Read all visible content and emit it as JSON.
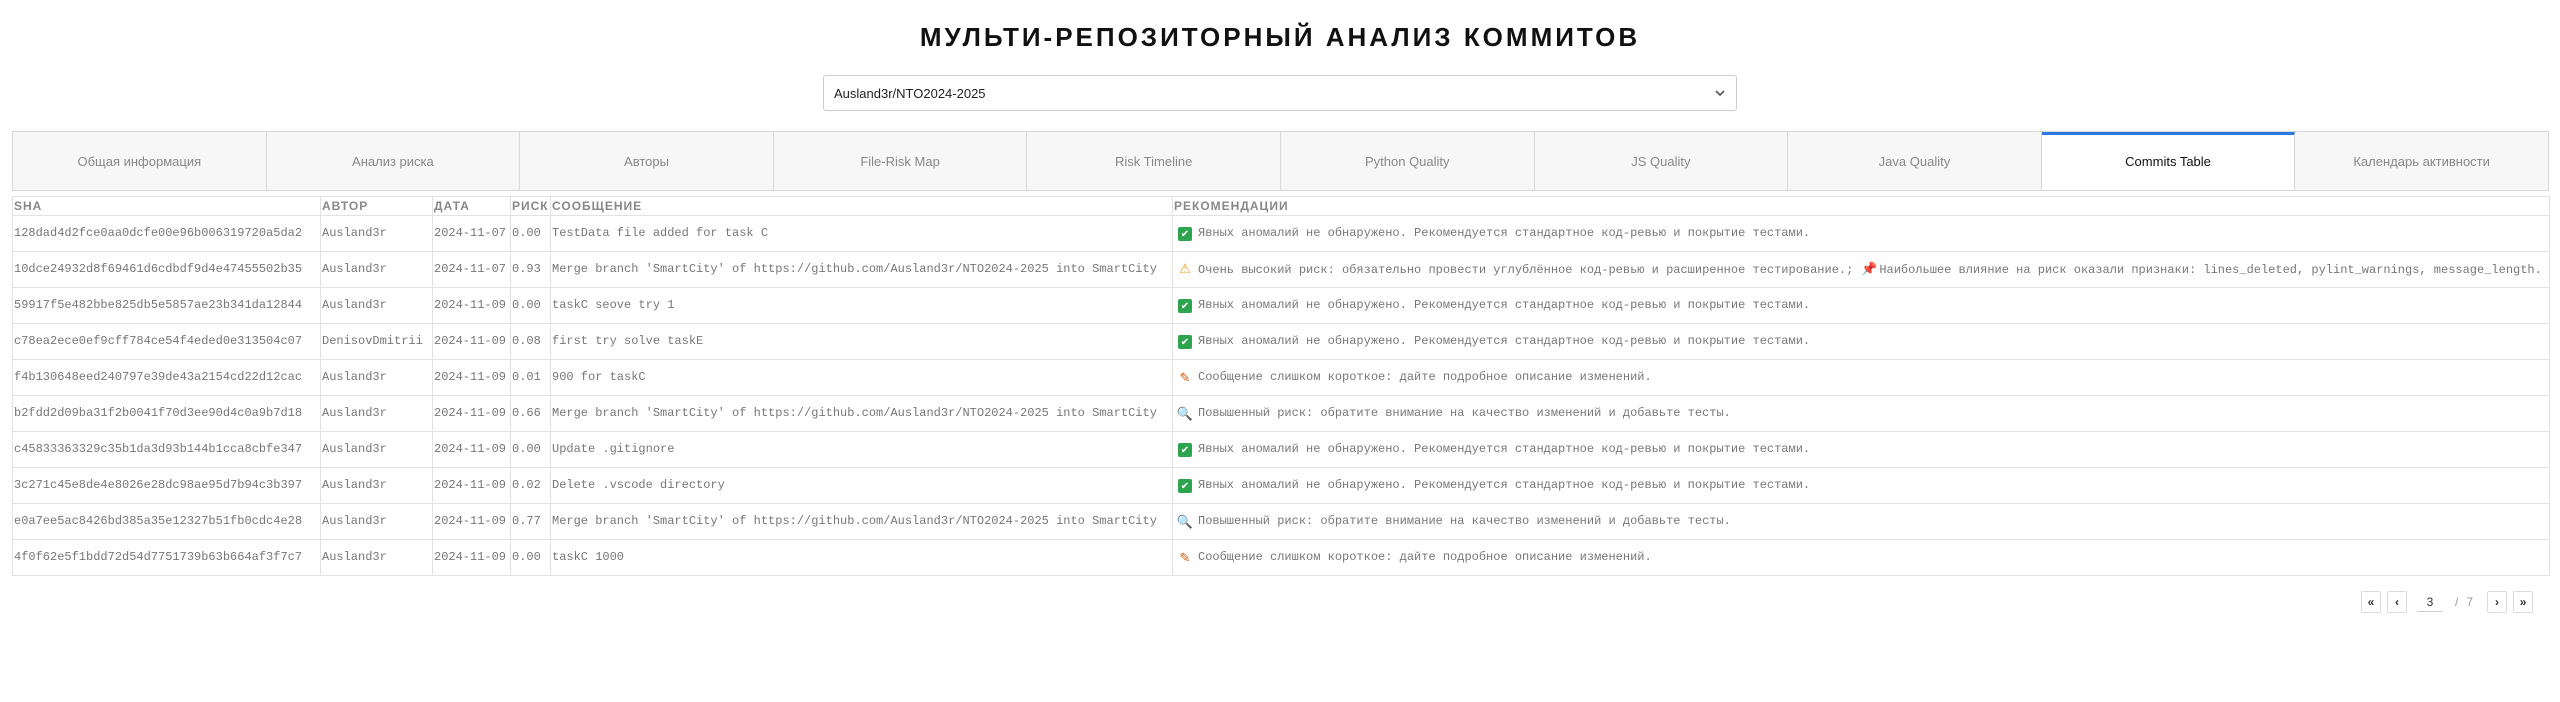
{
  "title": "МУЛЬТИ-РЕПОЗИТОРНЫЙ АНАЛИЗ КОММИТОВ",
  "repo_select": {
    "value": "Ausland3r/NTO2024-2025"
  },
  "tabs": [
    {
      "label": "Общая информация",
      "active": false
    },
    {
      "label": "Анализ риска",
      "active": false
    },
    {
      "label": "Авторы",
      "active": false
    },
    {
      "label": "File-Risk Map",
      "active": false
    },
    {
      "label": "Risk Timeline",
      "active": false
    },
    {
      "label": "Python Quality",
      "active": false
    },
    {
      "label": "JS Quality",
      "active": false
    },
    {
      "label": "Java Quality",
      "active": false
    },
    {
      "label": "Commits Table",
      "active": true
    },
    {
      "label": "Календарь активности",
      "active": false
    }
  ],
  "table": {
    "headers": [
      "SHA",
      "АВТОР",
      "ДАТА",
      "РИСК",
      "СООБЩЕНИЕ",
      "РЕКОМЕНДАЦИИ"
    ],
    "rows": [
      {
        "sha": "128dad4d2fce0aa0dcfe00e96b006319720a5da2",
        "author": "Ausland3r",
        "date": "2024-11-07",
        "risk": "0.00",
        "message": "TestData file added for task C",
        "rec_icon": "check-icon",
        "rec": "Явных аномалий не обнаружено. Рекомендуется стандартное код-ревью и покрытие тестами."
      },
      {
        "sha": "10dce24932d8f69461d6cdbdf9d4e47455502b35",
        "author": "Ausland3r",
        "date": "2024-11-07",
        "risk": "0.93",
        "message": "Merge branch 'SmartCity' of https://github.com/Ausland3r/NTO2024-2025 into SmartCity",
        "rec_icon": "warning-icon",
        "rec": "Очень высокий риск: обязательно провести углублённое код-ревью и расширенное тестирование.;",
        "rec_extra": "Наибольшее влияние на риск оказали признаки: lines_deleted, pylint_warnings, message_length."
      },
      {
        "sha": "59917f5e482bbe825db5e5857ae23b341da12844",
        "author": "Ausland3r",
        "date": "2024-11-09",
        "risk": "0.00",
        "message": "taskC seove try 1",
        "rec_icon": "check-icon",
        "rec": "Явных аномалий не обнаружено. Рекомендуется стандартное код-ревью и покрытие тестами."
      },
      {
        "sha": "c78ea2ece0ef9cff784ce54f4eded0e313504c07",
        "author": "DenisovDmitrii",
        "date": "2024-11-09",
        "risk": "0.08",
        "message": "first try solve taskE",
        "rec_icon": "check-icon",
        "rec": "Явных аномалий не обнаружено. Рекомендуется стандартное код-ревью и покрытие тестами."
      },
      {
        "sha": "f4b130648eed240797e39de43a2154cd22d12cac",
        "author": "Ausland3r",
        "date": "2024-11-09",
        "risk": "0.01",
        "message": "900 for taskC",
        "rec_icon": "pencil-icon",
        "rec": "Сообщение слишком короткое: дайте подробное описание изменений."
      },
      {
        "sha": "b2fdd2d09ba31f2b0041f70d3ee90d4c0a9b7d18",
        "author": "Ausland3r",
        "date": "2024-11-09",
        "risk": "0.66",
        "message": "Merge branch 'SmartCity' of https://github.com/Ausland3r/NTO2024-2025 into SmartCity",
        "rec_icon": "magnifier-icon",
        "rec": "Повышенный риск: обратите внимание на качество изменений и добавьте тесты."
      },
      {
        "sha": "c45833363329c35b1da3d93b144b1cca8cbfe347",
        "author": "Ausland3r",
        "date": "2024-11-09",
        "risk": "0.00",
        "message": "Update .gitignore",
        "rec_icon": "check-icon",
        "rec": "Явных аномалий не обнаружено. Рекомендуется стандартное код-ревью и покрытие тестами."
      },
      {
        "sha": "3c271c45e8de4e8026e28dc98ae95d7b94c3b397",
        "author": "Ausland3r",
        "date": "2024-11-09",
        "risk": "0.02",
        "message": "Delete .vscode directory",
        "rec_icon": "check-icon",
        "rec": "Явных аномалий не обнаружено. Рекомендуется стандартное код-ревью и покрытие тестами."
      },
      {
        "sha": "e0a7ee5ac8426bd385a35e12327b51fb0cdc4e28",
        "author": "Ausland3r",
        "date": "2024-11-09",
        "risk": "0.77",
        "message": "Merge branch 'SmartCity' of https://github.com/Ausland3r/NTO2024-2025 into SmartCity",
        "rec_icon": "magnifier-icon",
        "rec": "Повышенный риск: обратите внимание на качество изменений и добавьте тесты."
      },
      {
        "sha": "4f0f62e5f1bdd72d54d7751739b63b664af3f7c7",
        "author": "Ausland3r",
        "date": "2024-11-09",
        "risk": "0.00",
        "message": "taskC 1000",
        "rec_icon": "pencil-icon",
        "rec": "Сообщение слишком короткое: дайте подробное описание изменений."
      }
    ]
  },
  "pagination": {
    "current": "3",
    "separator": "/",
    "total": "7"
  }
}
